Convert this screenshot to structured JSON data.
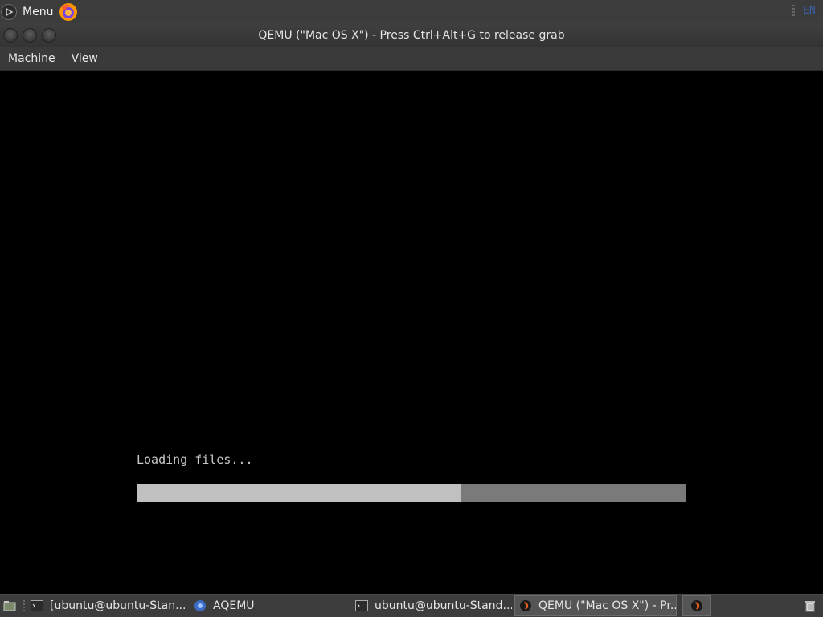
{
  "top_panel": {
    "menu_label": "Menu",
    "menu_icon": "mint-menu-icon",
    "browser_icon": "firefox-icon",
    "keyboard_layout": "EN"
  },
  "window": {
    "title": "QEMU (\"Mac OS X\") - Press Ctrl+Alt+G to release grab",
    "controls": [
      "close-icon",
      "minimize-icon",
      "maximize-icon"
    ]
  },
  "menubar": {
    "items": [
      "Machine",
      "View"
    ]
  },
  "guest": {
    "loading_text": "Loading files...",
    "progress": 0.59
  },
  "taskbar": {
    "items": [
      {
        "label": "[ubuntu@ubuntu-Stan...",
        "icon": "terminal-icon"
      },
      {
        "label": "AQEMU",
        "icon": "aqemu-icon"
      },
      {
        "label": "ubuntu@ubuntu-Stand...",
        "icon": "terminal-icon"
      },
      {
        "label": "QEMU (\"Mac OS X\") - Pr...",
        "icon": "qemu-icon"
      }
    ],
    "tray_icons": [
      "show-desktop-icon",
      "qemu-icon",
      "trash-icon"
    ]
  },
  "colors": {
    "panel_bg": "#3c3c3c",
    "progress_fill": "#c0c0c0",
    "progress_track": "#7a7a7a",
    "keyboard_layout": "#3a5fa8"
  }
}
